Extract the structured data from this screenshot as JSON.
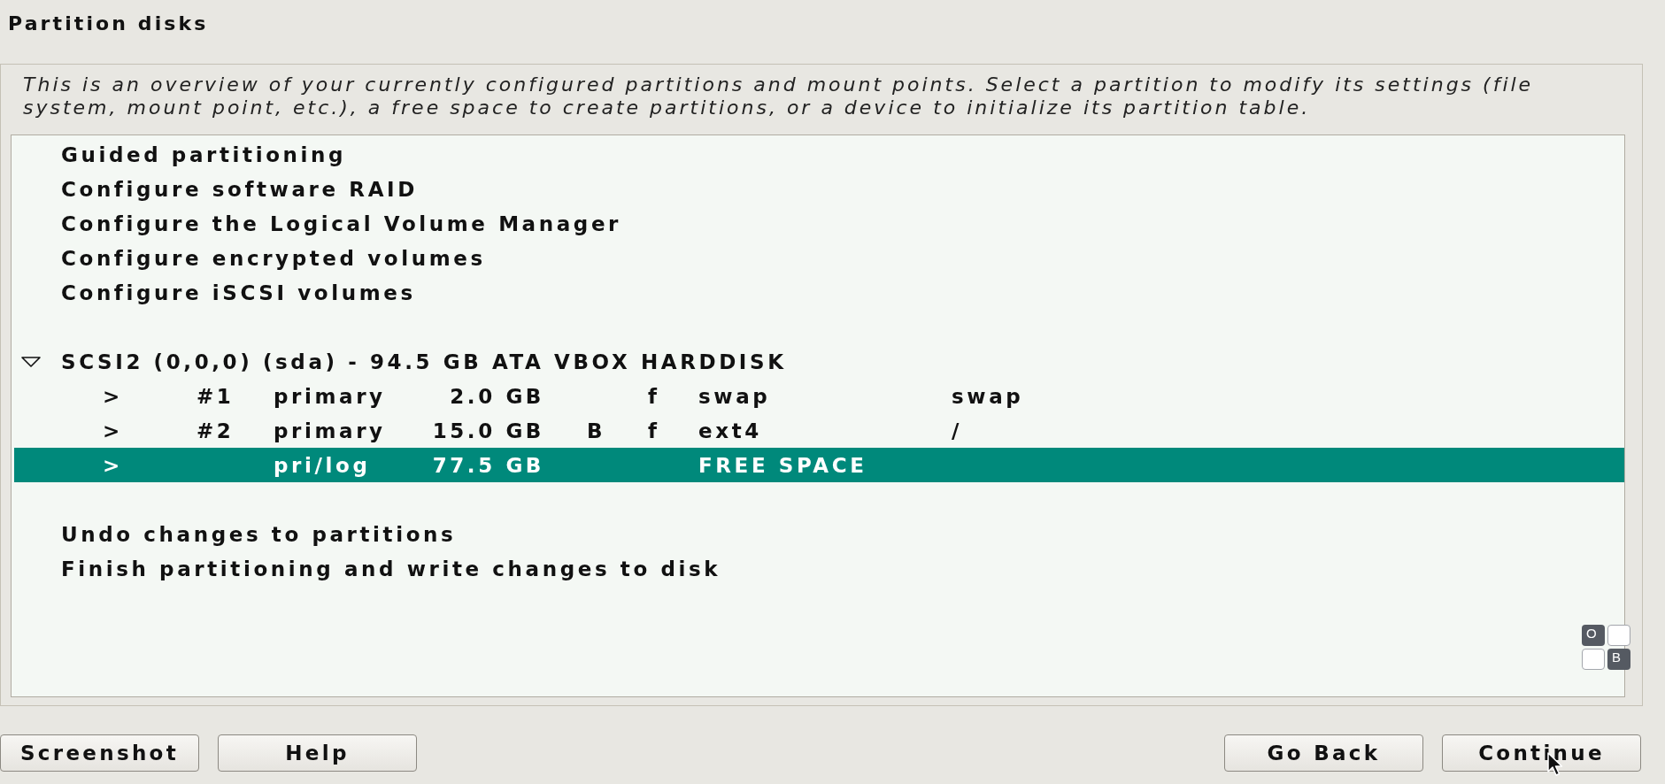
{
  "title": "Partition disks",
  "description": "This is an overview of your currently configured partitions and mount points. Select a partition to modify its settings (file system, mount point, etc.), a free space to create partitions, or a device to initialize its partition table.",
  "sections": [
    {
      "items": [
        {
          "kind": "action",
          "label": "Guided partitioning",
          "selected": false
        },
        {
          "kind": "action",
          "label": "Configure software RAID",
          "selected": false
        },
        {
          "kind": "action",
          "label": "Configure the Logical Volume Manager",
          "selected": false
        },
        {
          "kind": "action",
          "label": "Configure encrypted volumes",
          "selected": false
        },
        {
          "kind": "action",
          "label": "Configure iSCSI volumes",
          "selected": false
        }
      ]
    },
    {
      "items": [
        {
          "kind": "disk",
          "label": "SCSI2 (0,0,0) (sda) - 94.5 GB ATA VBOX HARDDISK",
          "expanded": true,
          "selected": false,
          "children": [
            {
              "marker": ">",
              "number": "#1",
              "type": "primary",
              "size": "2.0 GB",
              "format_flag": "f",
              "filesystem": "swap",
              "mount": "swap",
              "selected": false
            },
            {
              "marker": ">",
              "number": "#2",
              "type": "primary",
              "size": "15.0 GB",
              "boot_flag": "B",
              "format_flag": "f",
              "filesystem": "ext4",
              "mount": "/",
              "selected": false
            },
            {
              "marker": ">",
              "type": "pri/log",
              "size": "77.5 GB",
              "filesystem": "FREE SPACE",
              "selected": true
            }
          ]
        }
      ]
    },
    {
      "items": [
        {
          "kind": "action",
          "label": "Undo changes to partitions",
          "selected": false
        },
        {
          "kind": "action",
          "label": "Finish partitioning and write changes to disk",
          "selected": false
        }
      ]
    }
  ],
  "indicator": {
    "tiles": [
      {
        "label": "O",
        "on": true
      },
      {
        "on": false
      },
      {
        "on": false
      },
      {
        "label": "B",
        "on": true
      }
    ]
  },
  "left_buttons": [
    "Screenshot",
    "Help"
  ],
  "right_buttons": [
    "Go Back",
    "Continue"
  ]
}
